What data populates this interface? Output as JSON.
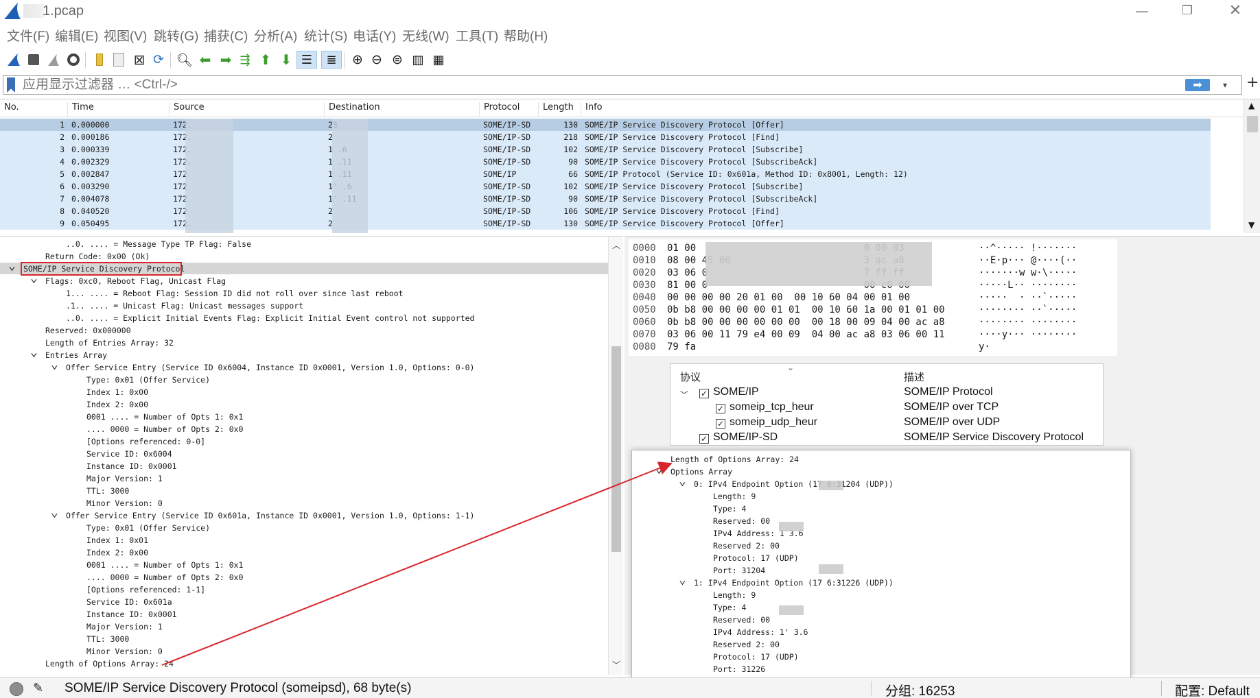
{
  "window": {
    "title": "1.pcap",
    "min_glyph": "—",
    "max_glyph": "❐",
    "close_glyph": "✕"
  },
  "menu": [
    "文件(F)",
    "编辑(E)",
    "视图(V)",
    "跳转(G)",
    "捕获(C)",
    "分析(A)",
    "统计(S)",
    "电话(Y)",
    "无线(W)",
    "工具(T)",
    "帮助(H)"
  ],
  "toolbar": {
    "icons": [
      "shark-fin-start-icon",
      "stop-icon",
      "restart-icon",
      "options-gear-icon",
      "open-folder-icon",
      "save-file-icon",
      "close-file-icon",
      "reload-icon",
      "find-icon",
      "back-arrow-icon",
      "forward-arrow-icon",
      "goto-packet-icon",
      "first-packet-icon",
      "last-packet-icon",
      "autoscroll-icon",
      "colorize-icon",
      "zoom-in-icon",
      "zoom-out-icon",
      "zoom-normal-icon",
      "resize-columns-icon",
      "layout-icon"
    ]
  },
  "filter": {
    "placeholder": "应用显示过滤器 … <Ctrl-/>",
    "apply_glyph": "➡",
    "dropdown_glyph": "▾",
    "add_glyph": "+"
  },
  "packet_list": {
    "columns": [
      "No.",
      "Time",
      "Source",
      "Destination",
      "Protocol",
      "Length",
      "Info"
    ],
    "rows": [
      {
        "no": "1",
        "time": "0.000000",
        "src": "172.",
        "dst": "23",
        "proto": "SOME/IP-SD",
        "len": "130",
        "info": "SOME/IP Service Discovery Protocol [Offer]"
      },
      {
        "no": "2",
        "time": "0.000186",
        "src": "172.",
        "dst": "2",
        "proto": "SOME/IP-SD",
        "len": "218",
        "info": "SOME/IP Service Discovery Protocol [Find]"
      },
      {
        "no": "3",
        "time": "0.000339",
        "src": "172.",
        "dst": "1               .6",
        "proto": "SOME/IP-SD",
        "len": "102",
        "info": "SOME/IP Service Discovery Protocol [Subscribe]"
      },
      {
        "no": "4",
        "time": "0.002329",
        "src": "172.",
        "dst": "1              .11",
        "proto": "SOME/IP-SD",
        "len": "90",
        "info": "SOME/IP Service Discovery Protocol [SubscribeAck]"
      },
      {
        "no": "5",
        "time": "0.002847",
        "src": "172",
        "dst": "1              .11",
        "proto": "SOME/IP",
        "len": "66",
        "info": "SOME/IP Protocol (Service ID: 0x601a, Method ID: 0x8001, Length: 12)"
      },
      {
        "no": "6",
        "time": "0.003290",
        "src": "172",
        "dst": "1'              .6",
        "proto": "SOME/IP-SD",
        "len": "102",
        "info": "SOME/IP Service Discovery Protocol [Subscribe]"
      },
      {
        "no": "7",
        "time": "0.004078",
        "src": "172",
        "dst": "1'             .11",
        "proto": "SOME/IP-SD",
        "len": "90",
        "info": "SOME/IP Service Discovery Protocol [SubscribeAck]"
      },
      {
        "no": "8",
        "time": "0.040520",
        "src": "172",
        "dst": "2",
        "proto": "SOME/IP-SD",
        "len": "106",
        "info": "SOME/IP Service Discovery Protocol [Find]"
      },
      {
        "no": "9",
        "time": "0.050495",
        "src": "172.",
        "dst": "2",
        "proto": "SOME/IP-SD",
        "len": "130",
        "info": "SOME/IP Service Discovery Protocol [Offer]"
      }
    ]
  },
  "tree": {
    "lines": [
      "..0. .... = Message Type TP Flag: False",
      "Return Code: 0x00 (Ok)",
      "SOME/IP Service Discovery Protocol",
      "Flags: 0xc0, Reboot Flag, Unicast Flag",
      "1... .... = Reboot Flag: Session ID did not roll over since last reboot",
      ".1.. .... = Unicast Flag: Unicast messages support",
      "..0. .... = Explicit Initial Events Flag: Explicit Initial Event control not supported",
      "Reserved: 0x000000",
      "Length of Entries Array: 32",
      "Entries Array",
      "Offer Service Entry (Service ID 0x6004, Instance ID 0x0001, Version 1.0, Options: 0-0)",
      "Type: 0x01 (Offer Service)",
      "Index 1: 0x00",
      "Index 2: 0x00",
      "0001 .... = Number of Opts 1: 0x1",
      ".... 0000 = Number of Opts 2: 0x0",
      "[Options referenced: 0-0]",
      "Service ID: 0x6004",
      "Instance ID: 0x0001",
      "Major Version: 1",
      "TTL: 3000",
      "Minor Version: 0",
      "Offer Service Entry (Service ID 0x601a, Instance ID 0x0001, Version 1.0, Options: 1-1)",
      "Type: 0x01 (Offer Service)",
      "Index 1: 0x01",
      "Index 2: 0x00",
      "0001 .... = Number of Opts 1: 0x1",
      ".... 0000 = Number of Opts 2: 0x0",
      "[Options referenced: 1-1]",
      "Service ID: 0x601a",
      "Instance ID: 0x0001",
      "Major Version: 1",
      "TTL: 3000",
      "Minor Version: 0",
      "Length of Options Array: 24"
    ]
  },
  "hex": {
    "offsets": [
      "0000",
      "0010",
      "0020",
      "0030",
      "0040",
      "0050",
      "0060",
      "0070",
      "0080"
    ],
    "bytes": [
      "01 00                             0 00 03",
      "08 00 45 00                       3 ac a8",
      "03 06 0                           7 ff ff",
      "81 00 0                           00 c0 00",
      "00 00 00 00 20 01 00  00 10 60 04 00 01 00",
      "0b b8 00 00 00 00 01 01  00 10 60 1a 00 01 01 00",
      "0b b8 00 00 00 00 00 00  00 18 00 09 04 00 ac a8",
      "03 06 00 11 79 e4 00 09  04 00 ac a8 03 06 00 11",
      "79 fa"
    ],
    "ascii": [
      "··^····· !·······",
      "··E·p··· @····(··",
      "·······w w·\\·····",
      "·····L·· ········",
      "·····  · ··`·····",
      "········ ··`·····",
      "········ ········",
      "····y··· ········",
      "y·"
    ]
  },
  "proto_dialog": {
    "col_protocol": "协议",
    "col_desc": "描述",
    "rows": [
      {
        "name": "SOME/IP",
        "desc": "SOME/IP Protocol",
        "checked": "✓"
      },
      {
        "name": "someip_tcp_heur",
        "desc": "SOME/IP over TCP",
        "checked": "✓"
      },
      {
        "name": "someip_udp_heur",
        "desc": "SOME/IP over UDP",
        "checked": "✓"
      },
      {
        "name": "SOME/IP-SD",
        "desc": "SOME/IP Service Discovery Protocol",
        "checked": "✓"
      }
    ]
  },
  "overlay": {
    "lines": [
      "Length of Options Array: 24",
      "Options Array",
      "0: IPv4 Endpoint Option (17         6:31204 (UDP))",
      "Length: 9",
      "Type: 4",
      "Reserved: 00",
      "IPv4 Address: 1        3.6",
      "Reserved 2: 00",
      "Protocol: 17 (UDP)",
      "Port: 31204",
      "1: IPv4 Endpoint Option (17         6:31226 (UDP))",
      "Length: 9",
      "Type: 4",
      "Reserved: 00",
      "IPv4 Address: 1'       3.6",
      "Reserved 2: 00",
      "Protocol: 17 (UDP)",
      "Port: 31226"
    ]
  },
  "status": {
    "text": "SOME/IP Service Discovery Protocol (someipsd), 68 byte(s)",
    "packets": "分组: 16253",
    "profile": "配置: Default"
  },
  "colors": {
    "row_bg": "#dbeaf9",
    "row_selected": "#b7cde3",
    "highlight_box": "#d9262d",
    "arrow": "#d9262d"
  }
}
